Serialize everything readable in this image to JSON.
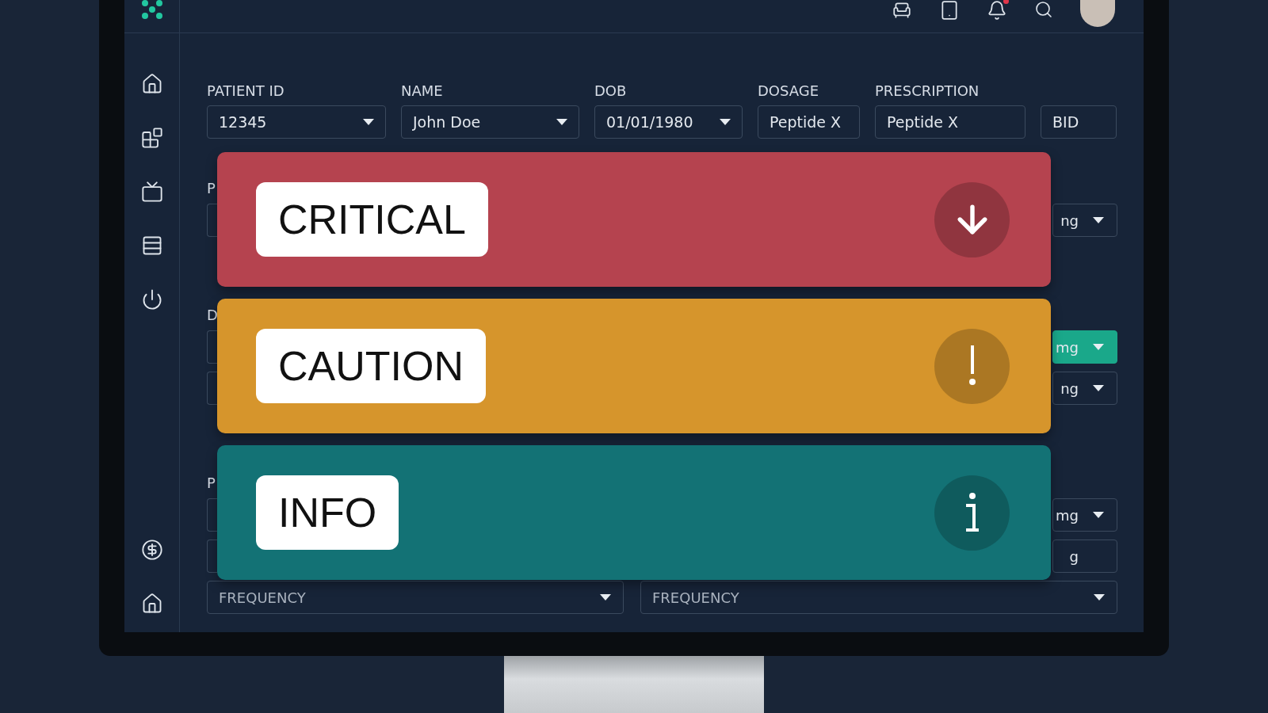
{
  "form": {
    "fields": [
      {
        "label": "PATIENT ID",
        "value": "12345",
        "dropdown": true
      },
      {
        "label": "NAME",
        "value": "John Doe",
        "dropdown": true
      },
      {
        "label": "DOB",
        "value": "01/01/1980",
        "dropdown": true
      },
      {
        "label": "DOSAGE",
        "value": "Peptide X",
        "dropdown": false
      },
      {
        "label": "PRESCRIPTION",
        "value": "Peptide X",
        "dropdown": false
      },
      {
        "value": "BID",
        "dropdown": false
      }
    ]
  },
  "sections": [
    {
      "label": "P",
      "rows": [
        {
          "value": "ng",
          "dropdown": true,
          "selected": false
        }
      ]
    },
    {
      "label": "D",
      "rows": [
        {
          "value": "mg",
          "dropdown": true,
          "selected": true
        },
        {
          "value": "ng",
          "dropdown": true,
          "selected": false
        }
      ]
    },
    {
      "label": "P",
      "rows": [
        {
          "value": "mg",
          "dropdown": true,
          "selected": false
        },
        {
          "value": "g",
          "dropdown": false,
          "selected": false
        }
      ]
    }
  ],
  "frequency_row": [
    {
      "placeholder": "FREQUENCY"
    },
    {
      "placeholder": "FREQUENCY"
    }
  ],
  "alerts": [
    {
      "kind": "critical",
      "label": "CRITICAL",
      "color": "#b5434f"
    },
    {
      "kind": "caution",
      "label": "CAUTION",
      "color": "#d6952c"
    },
    {
      "kind": "info",
      "label": "INFO",
      "color": "#137275"
    }
  ]
}
